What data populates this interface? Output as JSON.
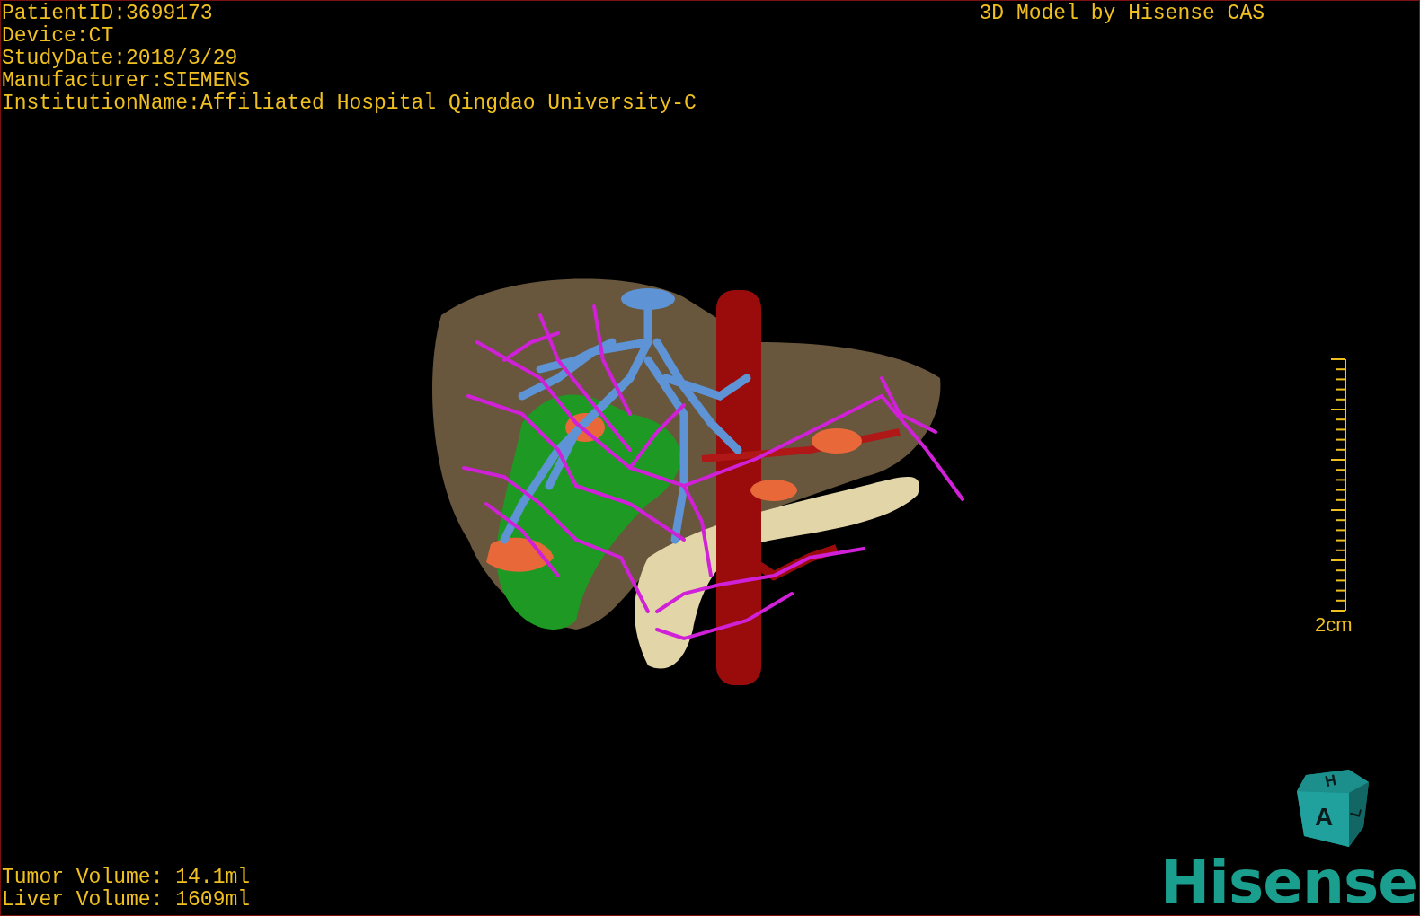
{
  "info_lines": [
    "PatientID:3699173",
    "Device:CT",
    "StudyDate:2018/3/29",
    "Manufacturer:SIEMENS",
    "InstitutionName:Affiliated Hospital Qingdao University-C"
  ],
  "title": "3D Model by Hisense CAS",
  "scale_bar": {
    "label": "2cm"
  },
  "volumes": [
    "Tumor Volume: 14.1ml",
    "Liver Volume: 1609ml"
  ],
  "orientation_cube": {
    "labels": [
      "H",
      "A",
      "L"
    ]
  },
  "logo": "Hisense"
}
